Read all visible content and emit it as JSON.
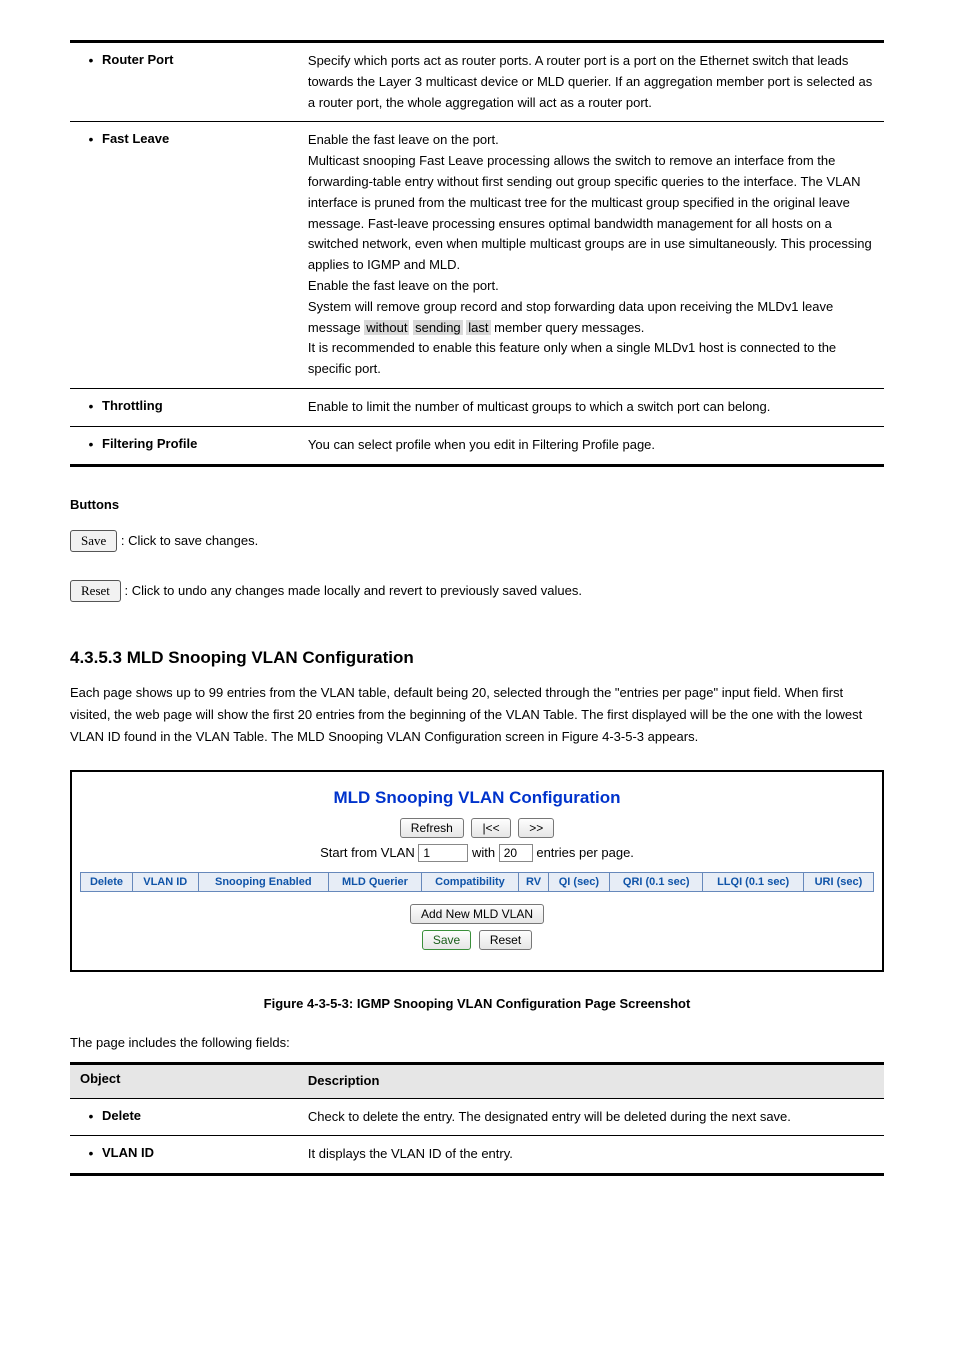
{
  "table1": {
    "rows": [
      {
        "label": "Router Port",
        "desc_plain": "Specify which ports act as router ports. A router port is a port on the Ethernet switch that leads towards the Layer 3 multicast device or MLD querier. If an aggregation member port is selected as a router port, the whole aggregation will act as a router port."
      },
      {
        "label": "Fast Leave",
        "desc_html": "Enable the fast leave on the port.<br>Multicast snooping Fast Leave processing allows the switch to remove an interface from the forwarding-table entry without first sending out group specific queries to the interface. The VLAN interface is pruned from the multicast tree for the multicast group specified in the original leave message. Fast-leave processing ensures optimal bandwidth management for all hosts on a switched network, even when multiple multicast groups are in use simultaneously. This processing applies to IGMP and MLD.<br>Enable the fast leave on the port.<br>System will remove group record and stop forwarding data upon receiving the MLDv1 leave message <span class=\"highlight\">without</span> <span class=\"highlight\">sending</span> <span class=\"highlight\">last</span> member query messages.<br>It is recommended to enable this feature only when a single MLDv1 host is connected to the specific port."
      },
      {
        "label": "Throttling",
        "desc_plain": "Enable to limit the number of multicast groups to which a switch port can belong."
      },
      {
        "label": "Filtering Profile",
        "desc_plain": "You can select profile when you edit in Filtering Profile page."
      }
    ]
  },
  "buttons_title": "Buttons",
  "save_label": "Save",
  "save_desc": ": Click to save changes.",
  "reset_label": "Reset",
  "reset_desc": ": Click to undo any changes made locally and revert to previously saved values.",
  "section_heading": "4.3.5.3 MLD Snooping VLAN Configuration",
  "section_body": "Each page shows up to 99 entries from the VLAN table, default being 20, selected through the \"entries per page\" input field. When first visited, the web page will show the first 20 entries from the beginning of the VLAN Table. The first displayed will be the one with the lowest VLAN ID found in the VLAN Table. The MLD Snooping VLAN Configuration screen in Figure 4-3-5-3 appears.",
  "screenshot": {
    "title": "MLD Snooping VLAN Configuration",
    "refresh": "Refresh",
    "first": "|<<",
    "next": ">>",
    "start_label_a": "Start from VLAN",
    "start_value": "1",
    "with_label": "with",
    "entries_value": "20",
    "entries_suffix": "entries per page.",
    "headers": [
      "Delete",
      "VLAN ID",
      "Snooping Enabled",
      "MLD Querier",
      "Compatibility",
      "RV",
      "QI (sec)",
      "QRI (0.1 sec)",
      "LLQI (0.1 sec)",
      "URI (sec)"
    ],
    "add_btn": "Add New MLD VLAN",
    "save_btn": "Save",
    "reset_btn": "Reset"
  },
  "fig_caption": "Figure 4-3-5-3: IGMP Snooping VLAN Configuration Page Screenshot",
  "intro2": "The page includes the following fields:",
  "table2": {
    "head_obj": "Object",
    "head_desc": "Description",
    "rows": [
      {
        "label": "Delete",
        "desc": "Check to delete the entry. The designated entry will be deleted during the next save."
      },
      {
        "label": "VLAN ID",
        "desc": "It displays the VLAN ID of the entry."
      }
    ]
  }
}
